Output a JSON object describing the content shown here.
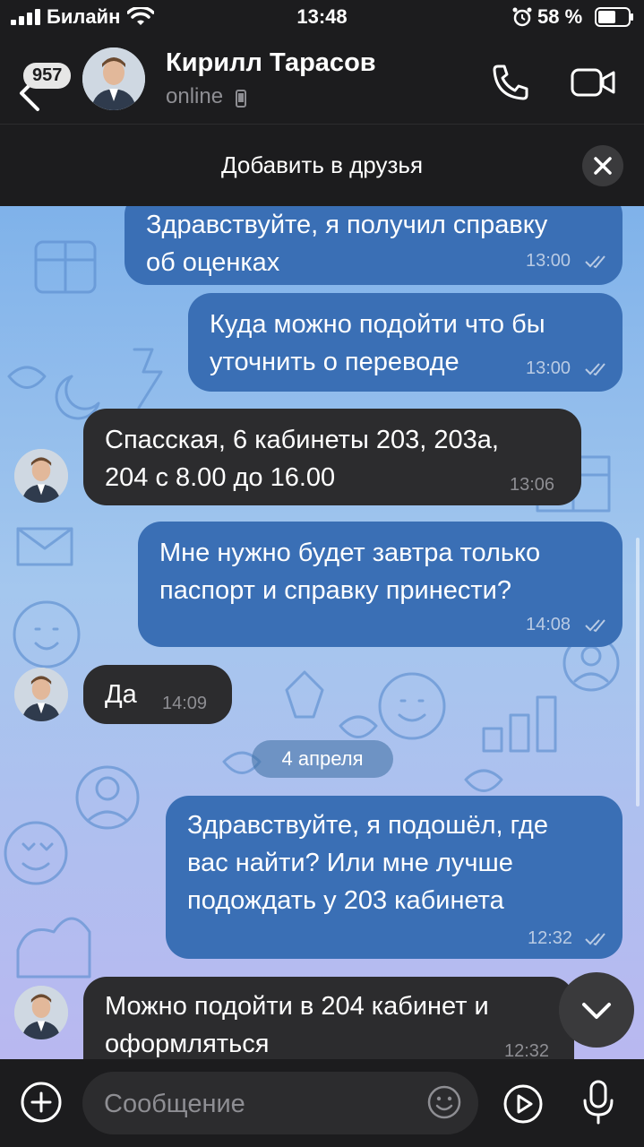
{
  "status_bar": {
    "carrier": "Билайн",
    "time": "13:48",
    "battery_percent": "58 %"
  },
  "header": {
    "unread_badge": "957",
    "contact_name": "Кирилл Тарасов",
    "presence": "online"
  },
  "add_friend_bar": {
    "label": "Добавить в друзья"
  },
  "messages": [
    {
      "direction": "out",
      "text": "Здравствуйте, я получил справку\nоб оценках",
      "time": "13:00",
      "read": true
    },
    {
      "direction": "out",
      "text": "Куда можно подойти что бы\nуточнить о переводе",
      "time": "13:00",
      "read": true
    },
    {
      "direction": "in",
      "text": "Спасская, 6 кабинеты 203, 203а,\n204 с 8.00 до 16.00",
      "time": "13:06"
    },
    {
      "direction": "out",
      "text": "Мне нужно будет завтра только\nпаспорт и справку принести?",
      "time": "14:08",
      "read": true
    },
    {
      "direction": "in",
      "text": "Да",
      "time": "14:09"
    },
    {
      "direction": "out",
      "text": "Здравствуйте, я подошёл, где\nвас найти? Или мне лучше\nподождать у 203 кабинета",
      "time": "12:32",
      "read": true
    },
    {
      "direction": "in",
      "text": "Можно подойти в 204 кабинет и\nоформляться",
      "time": "12:32"
    }
  ],
  "date_separator": "4 апреля",
  "composer": {
    "placeholder": "Сообщение"
  },
  "colors": {
    "outgoing_bubble": "#3a6fb5",
    "incoming_bubble": "#2c2c2e",
    "background_top": "#7fb2ea",
    "background_bottom": "#b9b8f0"
  },
  "icons": [
    "signal-icon",
    "wifi-icon",
    "alarm-icon",
    "battery-icon",
    "back-icon",
    "phone-icon",
    "call-icon",
    "video-call-icon",
    "close-icon",
    "checkmarks-icon",
    "chevron-down-icon",
    "plus-icon",
    "emoji-icon",
    "play-icon",
    "mic-icon"
  ]
}
